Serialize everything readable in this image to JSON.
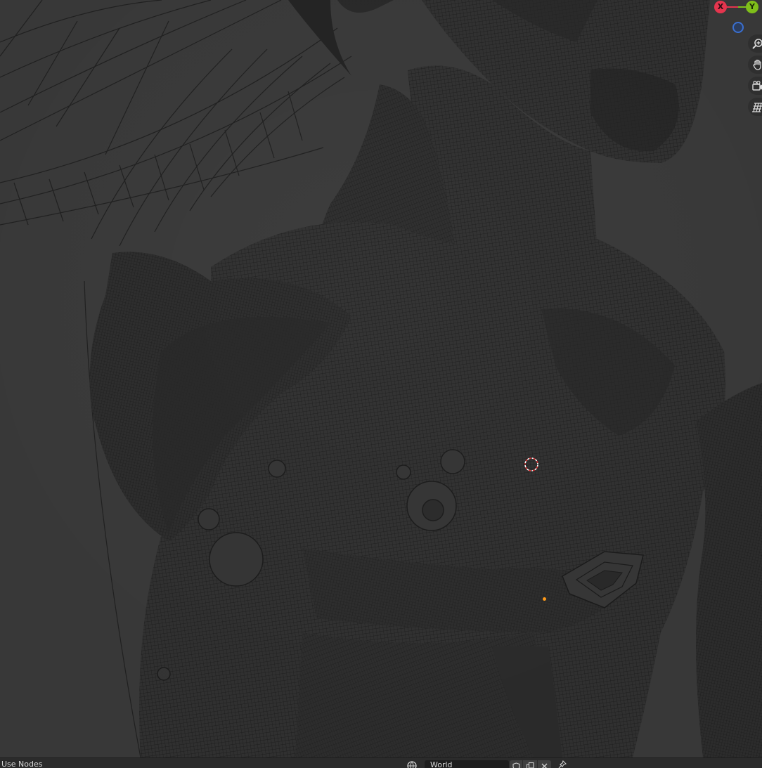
{
  "viewport": {
    "background_color": "#3d3d3d",
    "mesh_fill_color": "#333333",
    "wire_color": "#1a1a1a",
    "cursor_color_a": "#e03030",
    "cursor_color_b": "#ffffff",
    "origin_color": "#ff9a1a"
  },
  "gizmo": {
    "x_label": "X",
    "y_label": "Y",
    "x_color": "#e5354e",
    "y_color": "#7fbf1a",
    "z_color": "#3a6fd0"
  },
  "nav_buttons": [
    {
      "icon": "zoom-icon"
    },
    {
      "icon": "hand-pan-icon"
    },
    {
      "icon": "camera-icon"
    },
    {
      "icon": "grid-ortho-icon"
    }
  ],
  "header": {
    "editor_type": "Use Nodes",
    "world_name": "World",
    "world_icon": "world-icon",
    "buttons": [
      "shield-fake-user-icon",
      "duplicate-icon",
      "close-icon"
    ],
    "pin_icon": "pin-icon"
  }
}
